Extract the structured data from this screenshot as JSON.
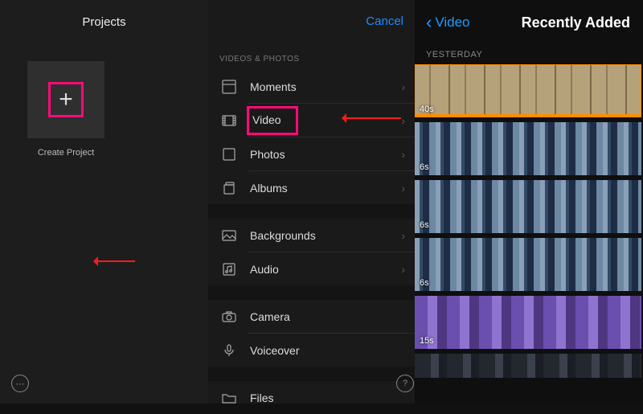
{
  "left": {
    "header": "Projects",
    "create_label": "Create Project",
    "plus": "+"
  },
  "mid": {
    "cancel": "Cancel",
    "section": "VIDEOS & PHOTOS",
    "items": [
      {
        "label": "Moments",
        "icon": "moments-icon"
      },
      {
        "label": "Video",
        "icon": "video-icon"
      },
      {
        "label": "Photos",
        "icon": "photos-icon"
      },
      {
        "label": "Albums",
        "icon": "albums-icon"
      }
    ],
    "items2": [
      {
        "label": "Backgrounds",
        "icon": "backgrounds-icon"
      },
      {
        "label": "Audio",
        "icon": "audio-icon"
      }
    ],
    "items3": [
      {
        "label": "Camera",
        "icon": "camera-icon"
      },
      {
        "label": "Voiceover",
        "icon": "voiceover-icon"
      }
    ],
    "items4": [
      {
        "label": "Files",
        "icon": "files-icon"
      }
    ]
  },
  "right": {
    "back": "Video",
    "title": "Recently Added",
    "day": "YESTERDAY",
    "clips": [
      {
        "duration": "40s"
      },
      {
        "duration": "6s"
      },
      {
        "duration": "6s"
      },
      {
        "duration": "6s"
      },
      {
        "duration": "15s"
      },
      {
        "duration": ""
      }
    ]
  },
  "icons": {
    "chevron_right": "›",
    "more": "⋯",
    "help": "?"
  }
}
